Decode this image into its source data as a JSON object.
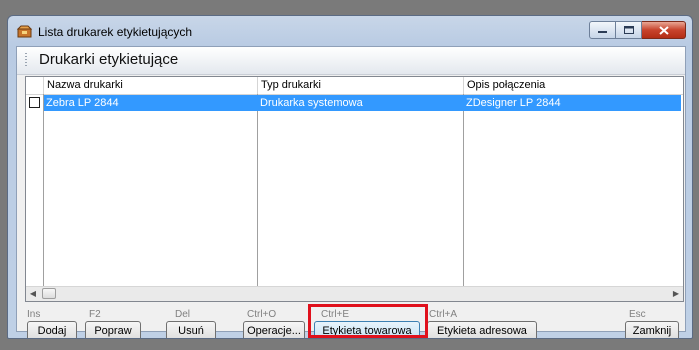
{
  "window": {
    "title": "Lista drukarek etykietujących"
  },
  "header": {
    "title": "Drukarki etykietujące"
  },
  "table": {
    "columns": [
      "Nazwa drukarki",
      "Typ drukarki",
      "Opis połączenia"
    ],
    "rows": [
      {
        "checked": false,
        "selected": true,
        "cells": [
          "Zebra LP 2844",
          "Drukarka systemowa",
          "ZDesigner LP 2844"
        ]
      }
    ]
  },
  "shortcuts": {
    "dodaj": "Ins",
    "popraw": "F2",
    "usun": "Del",
    "operacje": "Ctrl+O",
    "etykieta_towarowa": "Ctrl+E",
    "etykieta_adresowa": "Ctrl+A",
    "zamknij": "Esc"
  },
  "buttons": {
    "dodaj": "Dodaj",
    "popraw": "Popraw",
    "usun": "Usuń",
    "operacje": "Operacje...",
    "etykieta_towarowa": "Etykieta towarowa",
    "etykieta_adresowa": "Etykieta adresowa",
    "zamknij": "Zamknij"
  },
  "colors": {
    "selection": "#3399ff",
    "highlight_frame": "#e0101c",
    "close_button": "#c8432c"
  },
  "icons": {
    "app": "printer-box-icon",
    "min": "minimize-icon",
    "max": "maximize-icon",
    "close": "close-icon",
    "scroll_left": "chevron-left-icon",
    "scroll_right": "chevron-right-icon"
  }
}
